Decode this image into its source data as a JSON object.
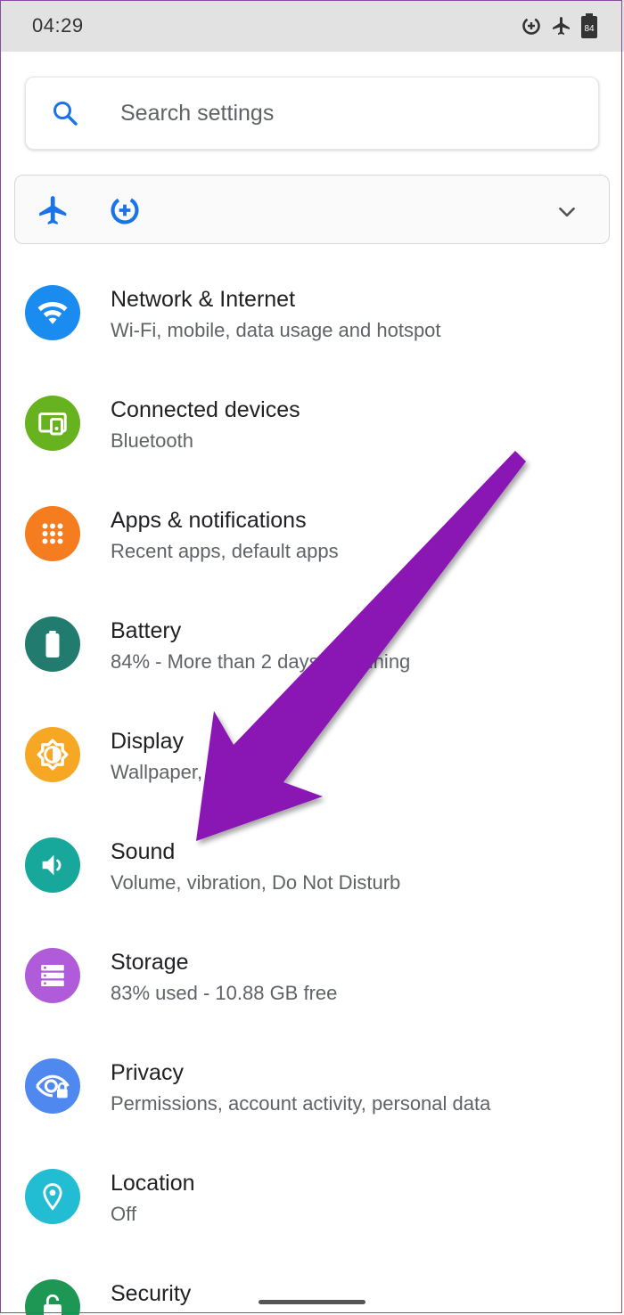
{
  "status_bar": {
    "time": "04:29",
    "battery_level": "84",
    "icons": [
      "data-saver-icon",
      "airplane-icon",
      "battery-icon"
    ]
  },
  "search": {
    "placeholder": "Search settings"
  },
  "conditions": {
    "icons": [
      "airplane-icon",
      "data-saver-icon"
    ],
    "expand_icon": "chevron-down-icon"
  },
  "settings": [
    {
      "title": "Network & Internet",
      "subtitle": "Wi-Fi, mobile, data usage and hotspot",
      "icon": "wifi-icon",
      "color": "#1a8cf0"
    },
    {
      "title": "Connected devices",
      "subtitle": "Bluetooth",
      "icon": "devices-icon",
      "color": "#67b21f"
    },
    {
      "title": "Apps & notifications",
      "subtitle": "Recent apps, default apps",
      "icon": "apps-icon",
      "color": "#f57c1f"
    },
    {
      "title": "Battery",
      "subtitle": "84% - More than 2 days remaining",
      "icon": "battery-icon",
      "color": "#217b6f"
    },
    {
      "title": "Display",
      "subtitle": "Wallpaper, font size",
      "icon": "brightness-icon",
      "color": "#f6a825"
    },
    {
      "title": "Sound",
      "subtitle": "Volume, vibration, Do Not Disturb",
      "icon": "volume-icon",
      "color": "#17a89b"
    },
    {
      "title": "Storage",
      "subtitle": "83% used - 10.88 GB free",
      "icon": "storage-icon",
      "color": "#b05bd9"
    },
    {
      "title": "Privacy",
      "subtitle": "Permissions, account activity, personal data",
      "icon": "privacy-icon",
      "color": "#4f88ee"
    },
    {
      "title": "Location",
      "subtitle": "Off",
      "icon": "location-icon",
      "color": "#22bcd3"
    },
    {
      "title": "Security",
      "subtitle": "",
      "icon": "lock-icon",
      "color": "#1e9654"
    }
  ],
  "colors": {
    "accent": "#1a73e8",
    "annotation_arrow": "#8a14b4"
  }
}
